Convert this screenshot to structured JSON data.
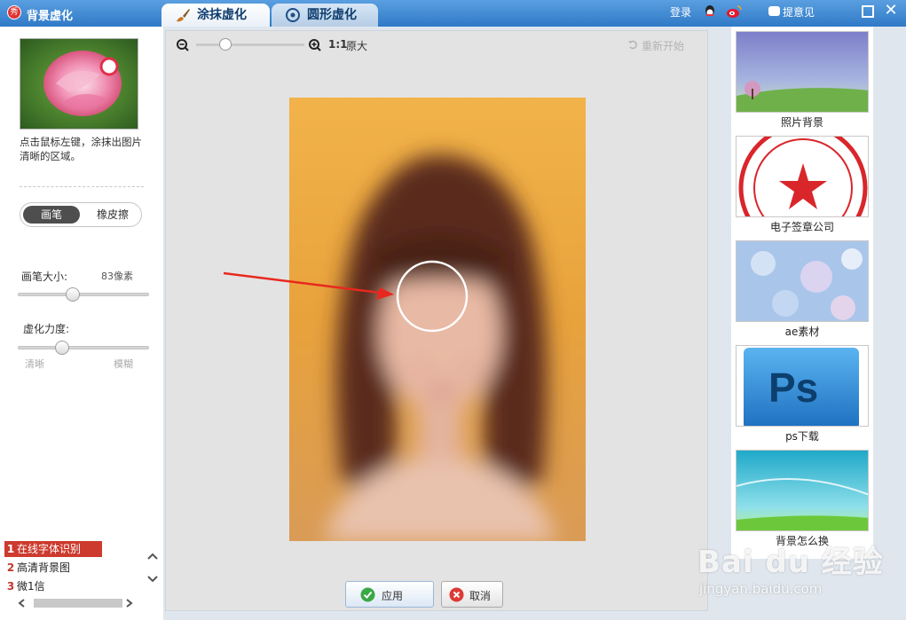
{
  "window": {
    "title": "背景虚化",
    "logo_text": "秀",
    "login": "登录",
    "feedback": "提意见"
  },
  "tabs": [
    {
      "label": "涂抹虚化",
      "active": true,
      "icon": "brush-icon"
    },
    {
      "label": "圆形虚化",
      "active": false,
      "icon": "circle-target-icon"
    }
  ],
  "left_panel": {
    "hint": "点击鼠标左键，涂抹出图片清晰的区域。",
    "mode_brush": "画笔",
    "mode_eraser": "橡皮擦",
    "brush_size_label": "画笔大小:",
    "brush_size_value": "83像素",
    "blur_strength_label": "虚化力度:",
    "blur_min_label": "清晰",
    "blur_max_label": "模糊",
    "brush_size_level": 0.38,
    "blur_strength_level": 0.3
  },
  "ad_list": [
    {
      "num": "1",
      "text": "在线字体识别",
      "selected": true
    },
    {
      "num": "2",
      "text": "高清背景图",
      "selected": false
    },
    {
      "num": "3",
      "text": "微1信",
      "selected": false
    }
  ],
  "toolbar": {
    "ratio": "1:1",
    "original_size": "原大",
    "restart": "重新开始",
    "zoom_level": 0.22
  },
  "buttons": {
    "apply": "应用",
    "cancel": "取消"
  },
  "right_panel": {
    "items": [
      {
        "caption": "照片背景"
      },
      {
        "caption": "电子签章公司"
      },
      {
        "caption": "ae素材"
      },
      {
        "caption": "ps下载"
      },
      {
        "caption": "背景怎么换"
      }
    ],
    "ps_text": "Ps"
  },
  "watermark": {
    "brand": "Bai du 经验",
    "url": "jingyan.baidu.com"
  },
  "colors": {
    "titlebar": "#2f79c6",
    "accent_red": "#cd3a2e",
    "annotation_arrow": "#e8281e"
  }
}
